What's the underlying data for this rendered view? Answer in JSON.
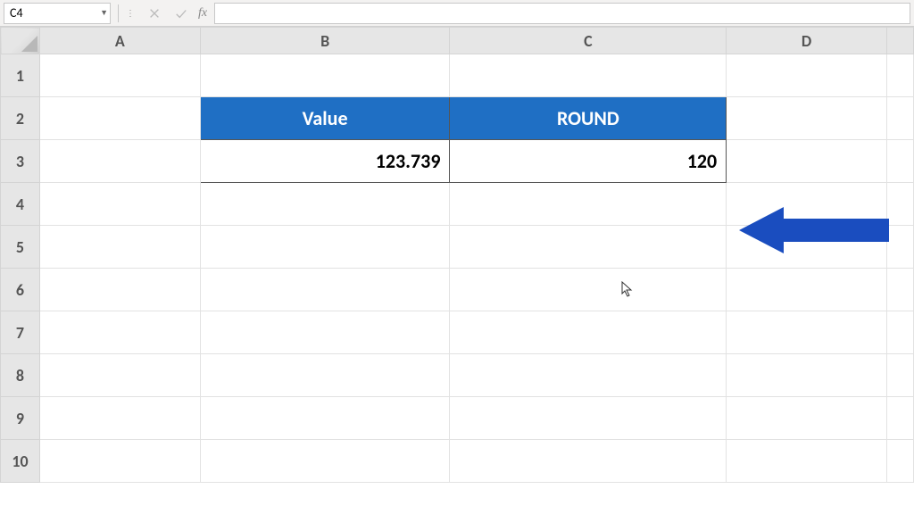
{
  "formula_bar": {
    "name_box": "C4",
    "fx_label": "fx",
    "formula_value": ""
  },
  "columns": [
    "A",
    "B",
    "C",
    "D",
    ""
  ],
  "rows": [
    "1",
    "2",
    "3",
    "4",
    "5",
    "6",
    "7",
    "8",
    "9",
    "10"
  ],
  "data_table": {
    "row2": {
      "B": "Value",
      "C": "ROUND"
    },
    "row3": {
      "B": "123.739",
      "C": "120"
    }
  }
}
